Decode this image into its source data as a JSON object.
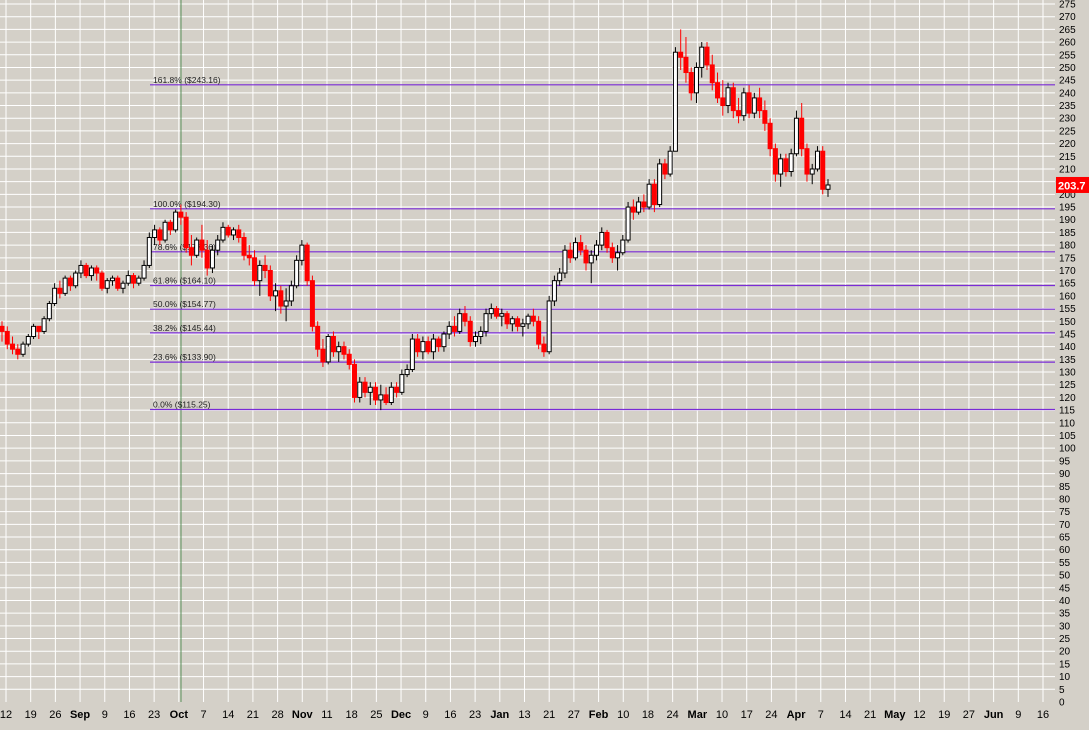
{
  "chart_data": {
    "type": "candlestick",
    "colors": {
      "background": "#d4d0c8",
      "grid": "#ffffff",
      "fib_line": "#7a2bd6",
      "up_candle": "#000000",
      "down_candle": "#ff0000",
      "price_badge": "#ff0000",
      "price_badge_text": "#ffffff",
      "axis_text": "#000000",
      "cursor_line": "#5a8f5a"
    },
    "y_axis": {
      "min": 0,
      "max": 275,
      "step": 5,
      "side": "right"
    },
    "x_ticks": [
      {
        "label": "12",
        "bold": false
      },
      {
        "label": "19",
        "bold": false
      },
      {
        "label": "26",
        "bold": false
      },
      {
        "label": "Sep",
        "bold": true
      },
      {
        "label": "9",
        "bold": false
      },
      {
        "label": "16",
        "bold": false
      },
      {
        "label": "23",
        "bold": false
      },
      {
        "label": "Oct",
        "bold": true
      },
      {
        "label": "7",
        "bold": false
      },
      {
        "label": "14",
        "bold": false
      },
      {
        "label": "21",
        "bold": false
      },
      {
        "label": "28",
        "bold": false
      },
      {
        "label": "Nov",
        "bold": true
      },
      {
        "label": "11",
        "bold": false
      },
      {
        "label": "18",
        "bold": false
      },
      {
        "label": "25",
        "bold": false
      },
      {
        "label": "Dec",
        "bold": true
      },
      {
        "label": "9",
        "bold": false
      },
      {
        "label": "16",
        "bold": false
      },
      {
        "label": "23",
        "bold": false
      },
      {
        "label": "Jan",
        "bold": true
      },
      {
        "label": "13",
        "bold": false
      },
      {
        "label": "21",
        "bold": false
      },
      {
        "label": "27",
        "bold": false
      },
      {
        "label": "Feb",
        "bold": true
      },
      {
        "label": "10",
        "bold": false
      },
      {
        "label": "18",
        "bold": false
      },
      {
        "label": "24",
        "bold": false
      },
      {
        "label": "Mar",
        "bold": true
      },
      {
        "label": "10",
        "bold": false
      },
      {
        "label": "17",
        "bold": false
      },
      {
        "label": "24",
        "bold": false
      },
      {
        "label": "Apr",
        "bold": true
      },
      {
        "label": "7",
        "bold": false
      },
      {
        "label": "14",
        "bold": false
      },
      {
        "label": "21",
        "bold": false
      },
      {
        "label": "May",
        "bold": true
      },
      {
        "label": "12",
        "bold": false
      },
      {
        "label": "19",
        "bold": false
      },
      {
        "label": "27",
        "bold": false
      },
      {
        "label": "Jun",
        "bold": true
      },
      {
        "label": "9",
        "bold": false
      },
      {
        "label": "16",
        "bold": false
      }
    ],
    "fib_levels": [
      {
        "label": "161.8%  ($243.16)",
        "value": 243.16
      },
      {
        "label": "100.0%  ($194.30)",
        "value": 194.3
      },
      {
        "label": "78.6%  ($177.36)",
        "value": 177.36
      },
      {
        "label": "61.8%  ($164.10)",
        "value": 164.1
      },
      {
        "label": "50.0%  ($154.77)",
        "value": 154.77
      },
      {
        "label": "38.2%  ($145.44)",
        "value": 145.44
      },
      {
        "label": "23.6%  ($133.90)",
        "value": 133.9
      },
      {
        "label": "0.0%  ($115.25)",
        "value": 115.25
      }
    ],
    "last_price": {
      "label": "203.7",
      "value": 203.7
    },
    "candles": [
      [
        148,
        150,
        142,
        146
      ],
      [
        146,
        148,
        139,
        141
      ],
      [
        141,
        144,
        137,
        139
      ],
      [
        139,
        141,
        135,
        137
      ],
      [
        137,
        142,
        136,
        141
      ],
      [
        141,
        145,
        140,
        144
      ],
      [
        144,
        149,
        143,
        148
      ],
      [
        148,
        147,
        143,
        146
      ],
      [
        146,
        152,
        145,
        151
      ],
      [
        151,
        158,
        150,
        157
      ],
      [
        157,
        165,
        156,
        163
      ],
      [
        163,
        166,
        159,
        161
      ],
      [
        161,
        168,
        160,
        167
      ],
      [
        167,
        168,
        162,
        164
      ],
      [
        164,
        170,
        163,
        169
      ],
      [
        169,
        174,
        167,
        172
      ],
      [
        172,
        173,
        167,
        168
      ],
      [
        168,
        172,
        166,
        171
      ],
      [
        171,
        172,
        166,
        169
      ],
      [
        169,
        170,
        162,
        163
      ],
      [
        163,
        167,
        161,
        166
      ],
      [
        166,
        168,
        164,
        167
      ],
      [
        167,
        168,
        162,
        163
      ],
      [
        163,
        166,
        161,
        165
      ],
      [
        165,
        170,
        164,
        168
      ],
      [
        168,
        169,
        163,
        165
      ],
      [
        165,
        168,
        164,
        167
      ],
      [
        167,
        174,
        166,
        172
      ],
      [
        172,
        185,
        171,
        183
      ],
      [
        183,
        188,
        180,
        186
      ],
      [
        186,
        187,
        180,
        182
      ],
      [
        182,
        190,
        181,
        189
      ],
      [
        189,
        190,
        184,
        186
      ],
      [
        186,
        194,
        185,
        193
      ],
      [
        193,
        196,
        188,
        191
      ],
      [
        191,
        193,
        177,
        179
      ],
      [
        179,
        184,
        172,
        176
      ],
      [
        176,
        183,
        175,
        182
      ],
      [
        182,
        188,
        175,
        178
      ],
      [
        178,
        182,
        168,
        171
      ],
      [
        171,
        180,
        169,
        178
      ],
      [
        178,
        184,
        176,
        182
      ],
      [
        182,
        189,
        181,
        187
      ],
      [
        187,
        188,
        183,
        184
      ],
      [
        184,
        187,
        182,
        186
      ],
      [
        186,
        188,
        181,
        183
      ],
      [
        183,
        185,
        174,
        176
      ],
      [
        176,
        180,
        172,
        175
      ],
      [
        175,
        178,
        164,
        166
      ],
      [
        166,
        174,
        160,
        172
      ],
      [
        172,
        176,
        167,
        170
      ],
      [
        170,
        172,
        158,
        160
      ],
      [
        160,
        165,
        154,
        162
      ],
      [
        162,
        164,
        153,
        156
      ],
      [
        156,
        163,
        150,
        158
      ],
      [
        158,
        166,
        156,
        164
      ],
      [
        164,
        176,
        163,
        174
      ],
      [
        174,
        182,
        172,
        180
      ],
      [
        180,
        181,
        164,
        166
      ],
      [
        166,
        168,
        146,
        148
      ],
      [
        148,
        150,
        136,
        139
      ],
      [
        139,
        143,
        132,
        134
      ],
      [
        134,
        145,
        133,
        144
      ],
      [
        144,
        146,
        136,
        138
      ],
      [
        138,
        142,
        134,
        140
      ],
      [
        140,
        142,
        135,
        137
      ],
      [
        137,
        139,
        131,
        133
      ],
      [
        133,
        135,
        118,
        120
      ],
      [
        120,
        128,
        118,
        126
      ],
      [
        126,
        128,
        120,
        122
      ],
      [
        122,
        126,
        117,
        124
      ],
      [
        124,
        126,
        117,
        119
      ],
      [
        119,
        125,
        115,
        121
      ],
      [
        121,
        124,
        117,
        118
      ],
      [
        118,
        126,
        117,
        124
      ],
      [
        124,
        126,
        120,
        122
      ],
      [
        122,
        131,
        121,
        129
      ],
      [
        129,
        133,
        128,
        131
      ],
      [
        131,
        145,
        130,
        143
      ],
      [
        143,
        145,
        136,
        138
      ],
      [
        138,
        144,
        135,
        142
      ],
      [
        142,
        144,
        137,
        138
      ],
      [
        138,
        145,
        135,
        143
      ],
      [
        143,
        144,
        138,
        140
      ],
      [
        140,
        146,
        138,
        145
      ],
      [
        145,
        150,
        143,
        148
      ],
      [
        148,
        152,
        144,
        146
      ],
      [
        146,
        155,
        145,
        153
      ],
      [
        153,
        156,
        148,
        150
      ],
      [
        150,
        152,
        140,
        142
      ],
      [
        142,
        146,
        140,
        144
      ],
      [
        144,
        148,
        141,
        146
      ],
      [
        146,
        155,
        144,
        153
      ],
      [
        153,
        157,
        151,
        155
      ],
      [
        155,
        156,
        151,
        152
      ],
      [
        152,
        155,
        148,
        153
      ],
      [
        153,
        154,
        147,
        149
      ],
      [
        149,
        152,
        146,
        151
      ],
      [
        151,
        152,
        146,
        148
      ],
      [
        148,
        151,
        144,
        149
      ],
      [
        149,
        153,
        147,
        152
      ],
      [
        152,
        155,
        148,
        150
      ],
      [
        150,
        152,
        139,
        141
      ],
      [
        141,
        144,
        136,
        138
      ],
      [
        138,
        160,
        137,
        158
      ],
      [
        158,
        168,
        156,
        166
      ],
      [
        166,
        171,
        164,
        169
      ],
      [
        169,
        180,
        167,
        178
      ],
      [
        178,
        181,
        173,
        175
      ],
      [
        175,
        183,
        174,
        181
      ],
      [
        181,
        184,
        176,
        178
      ],
      [
        178,
        180,
        170,
        173
      ],
      [
        173,
        178,
        165,
        176
      ],
      [
        176,
        182,
        174,
        180
      ],
      [
        180,
        187,
        178,
        185
      ],
      [
        185,
        186,
        177,
        179
      ],
      [
        179,
        181,
        173,
        175
      ],
      [
        175,
        180,
        170,
        177
      ],
      [
        177,
        184,
        176,
        182
      ],
      [
        182,
        197,
        181,
        195
      ],
      [
        195,
        198,
        190,
        193
      ],
      [
        193,
        199,
        192,
        197
      ],
      [
        197,
        200,
        193,
        195
      ],
      [
        195,
        206,
        194,
        204
      ],
      [
        204,
        206,
        193,
        196
      ],
      [
        196,
        214,
        195,
        212
      ],
      [
        212,
        214,
        206,
        208
      ],
      [
        208,
        219,
        207,
        217
      ],
      [
        217,
        258,
        230,
        256
      ],
      [
        256,
        265,
        249,
        254
      ],
      [
        254,
        262,
        244,
        248
      ],
      [
        248,
        250,
        237,
        240
      ],
      [
        240,
        252,
        236,
        250
      ],
      [
        250,
        260,
        246,
        258
      ],
      [
        258,
        260,
        249,
        251
      ],
      [
        251,
        255,
        241,
        244
      ],
      [
        244,
        248,
        236,
        238
      ],
      [
        238,
        245,
        231,
        235
      ],
      [
        235,
        244,
        232,
        242
      ],
      [
        242,
        244,
        230,
        233
      ],
      [
        233,
        238,
        228,
        231
      ],
      [
        231,
        242,
        229,
        240
      ],
      [
        240,
        243,
        230,
        232
      ],
      [
        232,
        240,
        230,
        238
      ],
      [
        238,
        242,
        230,
        233
      ],
      [
        233,
        237,
        225,
        228
      ],
      [
        228,
        230,
        215,
        218
      ],
      [
        218,
        220,
        205,
        208
      ],
      [
        208,
        216,
        203,
        214
      ],
      [
        214,
        216,
        207,
        209
      ],
      [
        209,
        218,
        207,
        216
      ],
      [
        216,
        233,
        215,
        230
      ],
      [
        230,
        236,
        215,
        218
      ],
      [
        218,
        220,
        205,
        208
      ],
      [
        208,
        212,
        204,
        210
      ],
      [
        210,
        219,
        209,
        217
      ],
      [
        217,
        219,
        200,
        202
      ],
      [
        202,
        206,
        199,
        203.7
      ]
    ]
  }
}
